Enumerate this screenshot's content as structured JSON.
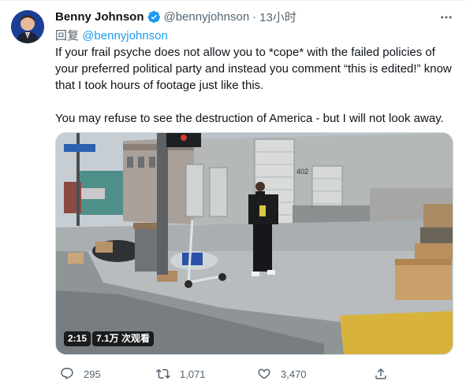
{
  "tweet": {
    "author_name": "Benny Johnson",
    "author_handle": "@bennyjohnson",
    "separator": "·",
    "time": "13小时",
    "reply_prefix": "回复",
    "reply_handle": "@bennyjohnson",
    "text_paragraph_1": "If your frail psyche does not allow you to *cope* with the failed policies of your preferred political party and instead you comment “this is edited!” know that I took hours of footage just like this.",
    "text_paragraph_2": "You may refuse to see the destruction of America - but I will not look away."
  },
  "media": {
    "type": "video",
    "duration": "2:15",
    "views": "7.1万 次观看",
    "building_number": "402"
  },
  "actions": {
    "reply_count": "295",
    "retweet_count": "1,071",
    "like_count": "3,470",
    "reply_icon": "reply-icon",
    "retweet_icon": "retweet-icon",
    "like_icon": "heart-icon",
    "share_icon": "share-icon"
  },
  "colors": {
    "link": "#1d9bf0",
    "secondary_text": "#536471",
    "primary_text": "#0f1419"
  }
}
